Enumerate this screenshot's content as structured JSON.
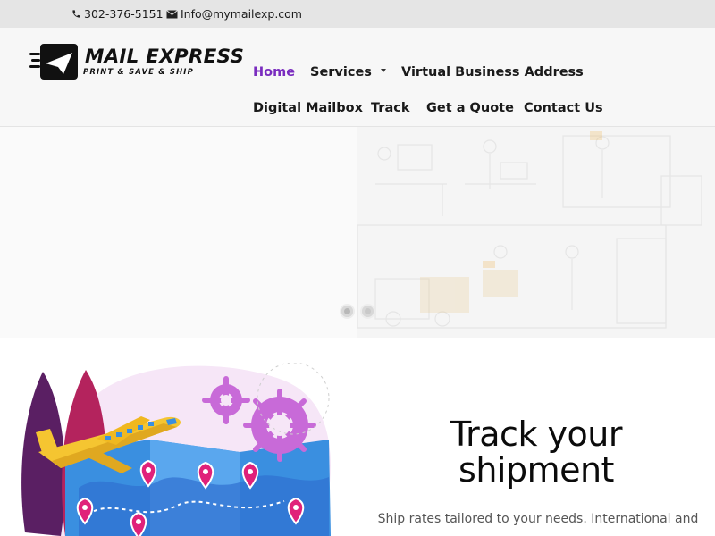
{
  "topbar": {
    "phone": "302-376-5151",
    "email": "Info@mymailexp.com",
    "icons": [
      "phone-icon",
      "envelope-icon"
    ]
  },
  "logo": {
    "title": "MAIL EXPRESS",
    "tagline": "PRINT & SAVE & SHIP"
  },
  "nav": {
    "items": [
      {
        "label": "Home",
        "active": true
      },
      {
        "label": "Services",
        "has_dropdown": true
      },
      {
        "label": "Virtual Business Address"
      },
      {
        "label": "Digital Mailbox"
      },
      {
        "label": "Track"
      },
      {
        "label": "Get a Quote"
      },
      {
        "label": "Contact Us"
      }
    ]
  },
  "slider": {
    "slide_count": 2,
    "active_index": 0
  },
  "feature": {
    "title_line1": "Track your",
    "title_line2": "shipment",
    "body": "Ship rates tailored to your needs. International and"
  },
  "colors": {
    "accent": "#7a2cbf",
    "topbar_bg": "#e5e5e5",
    "header_bg": "#f7f7f7"
  }
}
